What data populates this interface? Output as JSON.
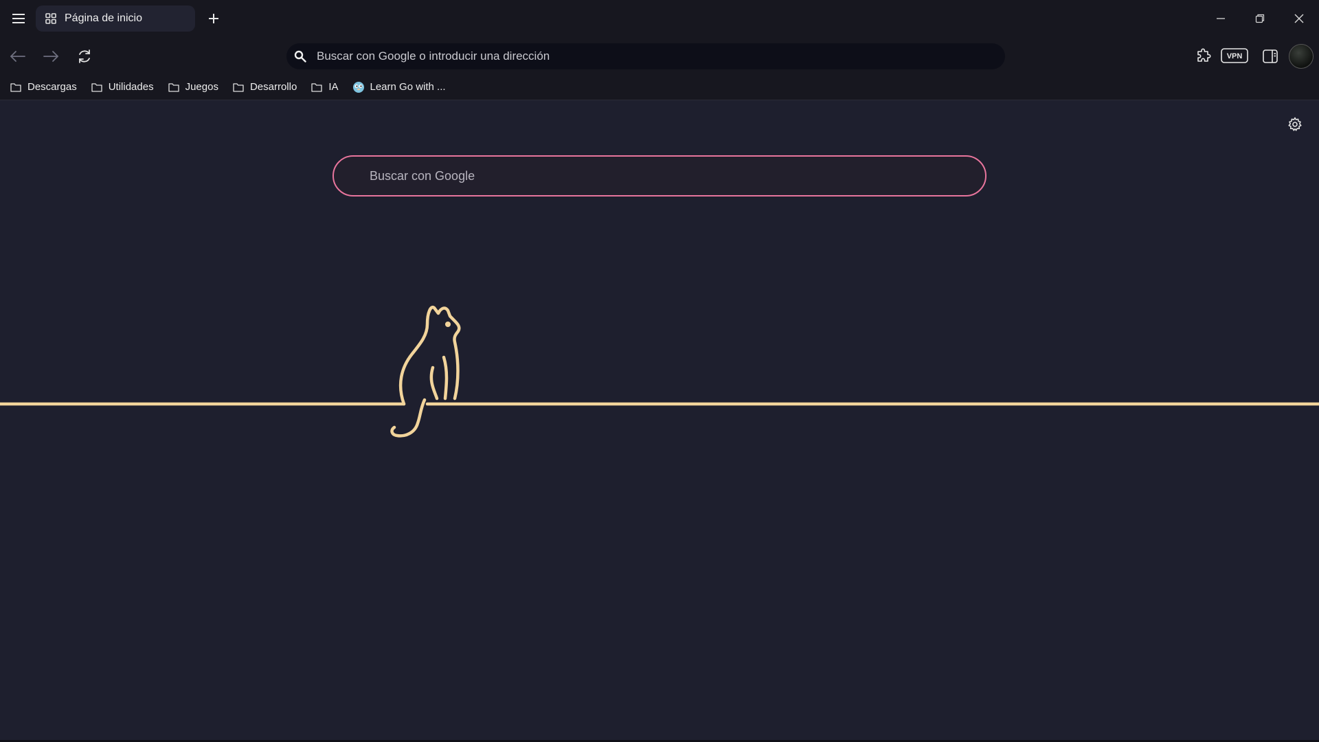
{
  "tab": {
    "title": "Página de inicio",
    "icon": "grid-icon"
  },
  "omnibox": {
    "placeholder": "Buscar con Google o introducir una dirección",
    "icon": "search-icon"
  },
  "toolbar": {
    "vpn_label": "VPN"
  },
  "bookmarks": [
    {
      "label": "Descargas",
      "icon": "folder-icon"
    },
    {
      "label": "Utilidades",
      "icon": "folder-icon"
    },
    {
      "label": "Juegos",
      "icon": "folder-icon"
    },
    {
      "label": "Desarrollo",
      "icon": "folder-icon"
    },
    {
      "label": "IA",
      "icon": "folder-icon"
    },
    {
      "label": "Learn Go with ...",
      "icon": "gopher-favicon-icon"
    }
  ],
  "main": {
    "search_placeholder": "Buscar con Google"
  },
  "colors": {
    "background": "#1e1f2e",
    "chrome": "#17171f",
    "search_border": "#e8759d",
    "line_art": "#f2d49b"
  }
}
